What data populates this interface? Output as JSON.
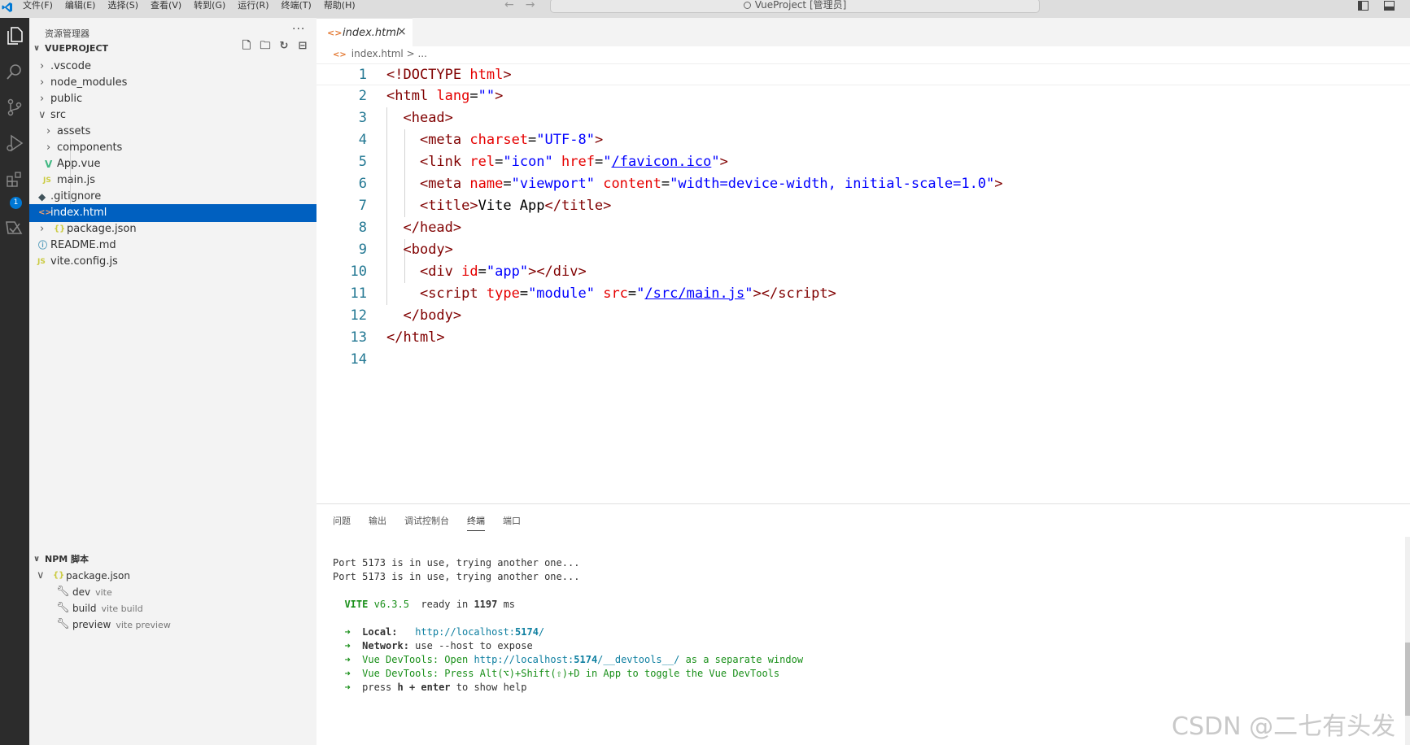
{
  "menu": [
    "文件(F)",
    "编辑(E)",
    "选择(S)",
    "查看(V)",
    "转到(G)",
    "运行(R)",
    "终端(T)",
    "帮助(H)"
  ],
  "command_center": "VueProject [管理员]",
  "activity_bar": {
    "extensions_badge": "1"
  },
  "explorer": {
    "title": "资源管理器",
    "more": "···",
    "project": "VUEPROJECT",
    "tree": [
      {
        "name": ".vscode",
        "type": "folder"
      },
      {
        "name": "node_modules",
        "type": "folder"
      },
      {
        "name": "public",
        "type": "folder"
      },
      {
        "name": "src",
        "type": "folder-open"
      },
      {
        "name": "assets",
        "type": "folder"
      },
      {
        "name": "components",
        "type": "folder"
      },
      {
        "name": "App.vue",
        "type": "vue"
      },
      {
        "name": "main.js",
        "type": "js",
        "icon_text": "JS"
      },
      {
        "name": ".gitignore",
        "type": "git"
      },
      {
        "name": "index.html",
        "type": "html"
      },
      {
        "name": "package.json",
        "type": "json",
        "icon_text": "{}"
      },
      {
        "name": "README.md",
        "type": "info"
      },
      {
        "name": "vite.config.js",
        "type": "js",
        "icon_text": "JS"
      }
    ]
  },
  "npm": {
    "title": "NPM 脚本",
    "package": "package.json",
    "scripts": [
      {
        "name": "dev",
        "cmd": "vite"
      },
      {
        "name": "build",
        "cmd": "vite build"
      },
      {
        "name": "preview",
        "cmd": "vite preview"
      }
    ]
  },
  "editor": {
    "tab_label": "index.html",
    "breadcrumb_file": "index.html",
    "breadcrumb_rest": "> ...",
    "line_numbers": [
      "1",
      "2",
      "3",
      "4",
      "5",
      "6",
      "7",
      "8",
      "9",
      "10",
      "11",
      "12",
      "13",
      "14"
    ]
  },
  "panel": {
    "tabs": [
      "问题",
      "输出",
      "调试控制台",
      "终端",
      "端口"
    ],
    "active_tab": "终端",
    "terminal": {
      "l1": "Port 5173 is in use, trying another one...",
      "l2": "Port 5173 is in use, trying another one...",
      "vite": "VITE",
      "version": "v6.3.5",
      "ready": "ready in",
      "ms": "1197",
      "ms_unit": "ms",
      "arrow": "➜",
      "local_label": "Local:",
      "local_url_a": "http://localhost:",
      "local_port": "5174",
      "local_url_b": "/",
      "network_label": "Network:",
      "network_text": "use --host to expose",
      "devtools_label": "Vue DevTools:",
      "devtools_open": "Open",
      "devtools_url_a": "http://localhost:",
      "devtools_port": "5174",
      "devtools_url_b": "/__devtools__/",
      "devtools_sep": "as a separate window",
      "devtools_press": "Press",
      "devtools_keys": "Alt(⌥)+Shift(⇧)+D",
      "devtools_toggle": "in App to toggle the Vue DevTools",
      "help_a": "press",
      "help_h": "h + enter",
      "help_b": "to show help"
    }
  },
  "watermark": "CSDN @二七有头发"
}
